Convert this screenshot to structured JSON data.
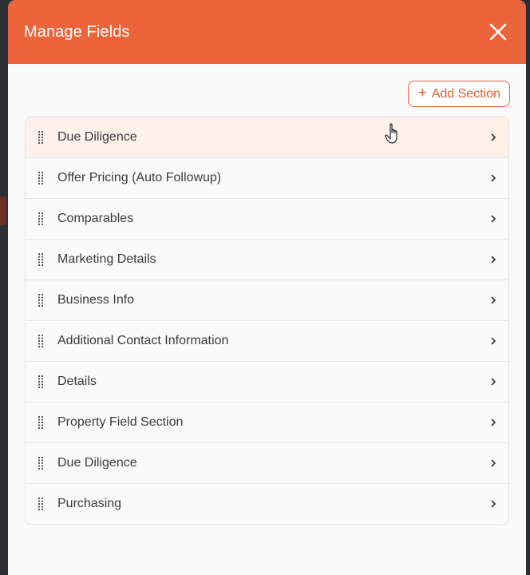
{
  "modal": {
    "title": "Manage Fields",
    "close_icon": "close-icon"
  },
  "toolbar": {
    "add_section_label": "Add Section",
    "add_icon": "plus-icon"
  },
  "sections": [
    {
      "label": "Due Diligence"
    },
    {
      "label": "Offer Pricing (Auto Followup)"
    },
    {
      "label": "Comparables"
    },
    {
      "label": "Marketing Details"
    },
    {
      "label": "Business Info"
    },
    {
      "label": "Additional Contact Information"
    },
    {
      "label": "Details"
    },
    {
      "label": "Property Field Section"
    },
    {
      "label": "Due Diligence"
    },
    {
      "label": "Purchasing"
    }
  ],
  "colors": {
    "accent": "#ec643c",
    "hover_row": "#fdf1ea",
    "text": "#3a3a3d"
  }
}
